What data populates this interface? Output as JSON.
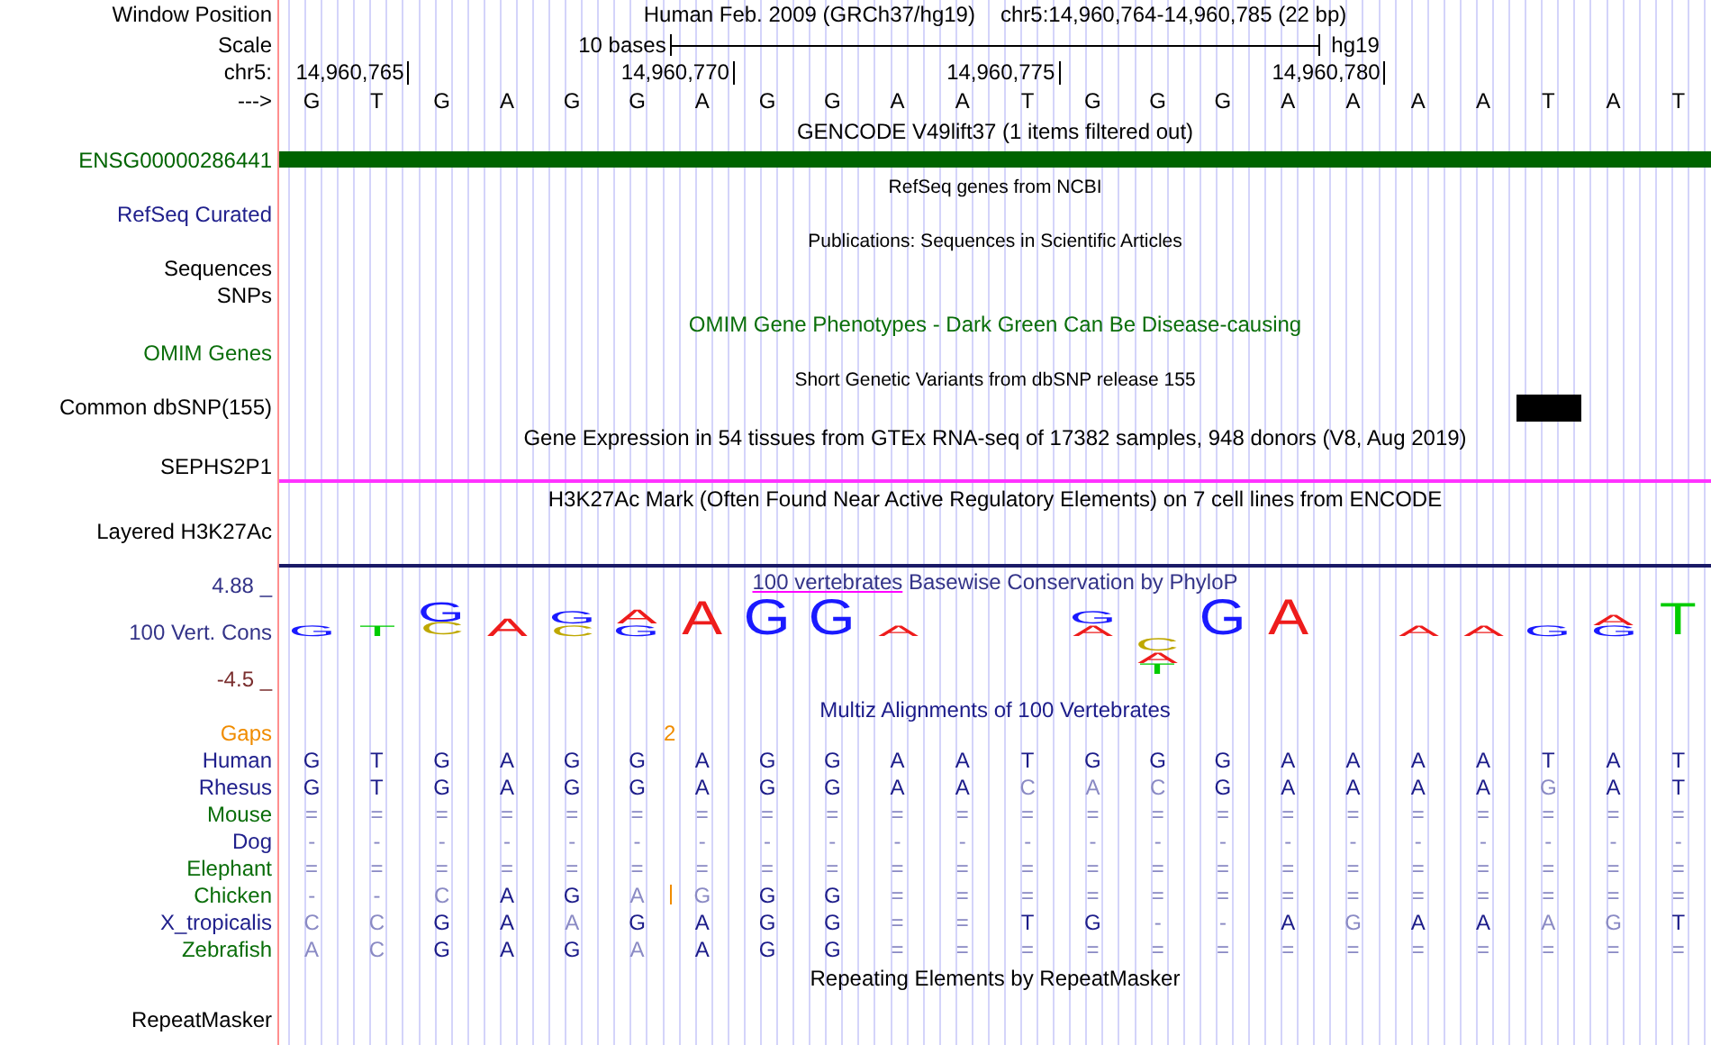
{
  "ruler": {
    "window_position_label": "Window Position",
    "assembly": "Human Feb. 2009 (GRCh37/hg19)",
    "position": "chr5:14,960,764-14,960,785 (22 bp)",
    "scale_label": "Scale",
    "scale_text": "10 bases",
    "scale_db": "hg19",
    "chrom_label": "chr5:",
    "ticks": [
      "14,960,765",
      "14,960,770",
      "14,960,775",
      "14,960,780"
    ],
    "strand_label": "--->",
    "bases": [
      "G",
      "T",
      "G",
      "A",
      "G",
      "G",
      "A",
      "G",
      "G",
      "A",
      "A",
      "T",
      "G",
      "G",
      "G",
      "A",
      "A",
      "A",
      "A",
      "T",
      "A",
      "T"
    ]
  },
  "tracks": [
    {
      "kind": "title",
      "text": "GENCODE V49lift37 (1 items filtered out)",
      "color": "#000000"
    },
    {
      "kind": "bar",
      "label": "ENSG00000286441",
      "color": "#006400"
    },
    {
      "kind": "subtitle",
      "text": "RefSeq genes from NCBI"
    },
    {
      "kind": "label",
      "label": "RefSeq Curated",
      "color": "#20208c"
    },
    {
      "kind": "subtitle",
      "text": "Publications: Sequences in Scientific Articles"
    },
    {
      "kind": "label",
      "label": "Sequences",
      "color": "#000000"
    },
    {
      "kind": "label",
      "label": "SNPs",
      "color": "#000000"
    },
    {
      "kind": "title",
      "text": "OMIM Gene Phenotypes - Dark Green Can Be Disease-causing",
      "color": "#0a6e0a"
    },
    {
      "kind": "label",
      "label": "OMIM Genes",
      "color": "#0a6e0a"
    },
    {
      "kind": "subtitle",
      "text": "Short Genetic Variants from dbSNP release 155"
    },
    {
      "kind": "variants",
      "label": "Common dbSNP(155)",
      "color": "#000000",
      "variants": [
        false,
        false,
        false,
        false,
        false,
        false,
        false,
        false,
        false,
        false,
        false,
        false,
        false,
        false,
        false,
        false,
        false,
        false,
        false,
        true,
        false,
        false
      ]
    },
    {
      "kind": "title",
      "text": "Gene Expression in 54 tissues from GTEx RNA-seq of 17382 samples, 948 donors (V8, Aug 2019)",
      "color": "#000000"
    },
    {
      "kind": "label",
      "label": "SEPHS2P1",
      "color": "#000000"
    },
    {
      "kind": "rule",
      "color": "#ff33ff"
    },
    {
      "kind": "title",
      "text": "H3K27Ac Mark (Often Found Near Active Regulatory Elements) on 7 cell lines from ENCODE",
      "color": "#000000"
    },
    {
      "kind": "signal",
      "label": "Layered H3K27Ac",
      "color": "#000000"
    },
    {
      "kind": "rule",
      "color": "#1a1a66"
    },
    {
      "kind": "conservation",
      "title_link": "100 vertebrates",
      "title_rest": "Basewise Conservation by PhyloP",
      "label": "100 Vert. Cons",
      "max": "4.88 _",
      "min": "-4.5 _",
      "columns": [
        {
          "kind": "up",
          "letters": [
            {
              "base": "G",
              "color": "#1a1aff"
            }
          ]
        },
        {
          "kind": "up",
          "letters": [
            {
              "base": "T",
              "color": "#00cc00"
            }
          ]
        },
        {
          "kind": "up",
          "letters": [
            {
              "base": "G",
              "color": "#1a1aff"
            },
            {
              "base": "C",
              "color": "#bfa800"
            }
          ]
        },
        {
          "kind": "up",
          "letters": [
            {
              "base": "A",
              "color": "#ee1c1c"
            }
          ]
        },
        {
          "kind": "up",
          "letters": [
            {
              "base": "G",
              "color": "#1a1aff"
            },
            {
              "base": "C",
              "color": "#bfa800"
            }
          ]
        },
        {
          "kind": "up",
          "letters": [
            {
              "base": "A",
              "color": "#ee1c1c"
            },
            {
              "base": "G",
              "color": "#1a1aff"
            }
          ]
        },
        {
          "kind": "up",
          "letters": [
            {
              "base": "A",
              "color": "#ee1c1c"
            }
          ]
        },
        {
          "kind": "up",
          "letters": [
            {
              "base": "G",
              "color": "#1a1aff"
            }
          ]
        },
        {
          "kind": "up",
          "letters": [
            {
              "base": "G",
              "color": "#1a1aff"
            }
          ]
        },
        {
          "kind": "up",
          "letters": [
            {
              "base": "A",
              "color": "#ee1c1c"
            }
          ]
        },
        {
          "kind": "none"
        },
        {
          "kind": "none"
        },
        {
          "kind": "up",
          "letters": [
            {
              "base": "G",
              "color": "#1a1aff"
            },
            {
              "base": "A",
              "color": "#ee1c1c"
            }
          ]
        },
        {
          "kind": "down",
          "letters": [
            {
              "base": "C",
              "color": "#bfa800"
            },
            {
              "base": "A",
              "color": "#ee1c1c"
            },
            {
              "base": "T",
              "color": "#00cc00"
            }
          ]
        },
        {
          "kind": "up",
          "letters": [
            {
              "base": "G",
              "color": "#1a1aff"
            }
          ]
        },
        {
          "kind": "up",
          "letters": [
            {
              "base": "A",
              "color": "#ee1c1c"
            }
          ]
        },
        {
          "kind": "none"
        },
        {
          "kind": "up",
          "letters": [
            {
              "base": "A",
              "color": "#ee1c1c"
            }
          ]
        },
        {
          "kind": "up",
          "letters": [
            {
              "base": "A",
              "color": "#ee1c1c"
            }
          ]
        },
        {
          "kind": "up",
          "letters": [
            {
              "base": "G",
              "color": "#1a1aff"
            }
          ]
        },
        {
          "kind": "up",
          "letters": [
            {
              "base": "A",
              "color": "#ee1c1c"
            },
            {
              "base": "G",
              "color": "#1a1aff"
            }
          ]
        },
        {
          "kind": "up",
          "letters": [
            {
              "base": "T",
              "color": "#00cc00"
            }
          ]
        }
      ]
    },
    {
      "kind": "alignment",
      "title": "Multiz Alignments of 100 Vertebrates",
      "gaps": {
        "label": "Gaps",
        "text": "2",
        "after": [
          false,
          false,
          false,
          false,
          false,
          true,
          false,
          false,
          false,
          false,
          false,
          false,
          false,
          false,
          false,
          false,
          false,
          false,
          false,
          false,
          false,
          false
        ]
      },
      "species": [
        {
          "label": "Human",
          "has_insertion": false,
          "color": "#20208c",
          "bases": [
            "G",
            "T",
            "G",
            "A",
            "G",
            "G",
            "A",
            "G",
            "G",
            "A",
            "A",
            "T",
            "G",
            "G",
            "G",
            "A",
            "A",
            "A",
            "A",
            "T",
            "A",
            "T"
          ],
          "dim": [
            false,
            false,
            false,
            false,
            false,
            false,
            false,
            false,
            false,
            false,
            false,
            false,
            false,
            false,
            false,
            false,
            false,
            false,
            false,
            false,
            false,
            false
          ]
        },
        {
          "label": "Rhesus",
          "has_insertion": false,
          "color": "#20208c",
          "bases": [
            "G",
            "T",
            "G",
            "A",
            "G",
            "G",
            "A",
            "G",
            "G",
            "A",
            "A",
            "C",
            "A",
            "C",
            "G",
            "A",
            "A",
            "A",
            "A",
            "G",
            "A",
            "T"
          ],
          "dim": [
            false,
            false,
            false,
            false,
            false,
            false,
            false,
            false,
            false,
            false,
            false,
            true,
            true,
            true,
            false,
            false,
            false,
            false,
            false,
            true,
            false,
            false
          ]
        },
        {
          "label": "Mouse",
          "has_insertion": false,
          "color": "#0a6e0a",
          "bases": [
            "=",
            "=",
            "=",
            "=",
            "=",
            "=",
            "=",
            "=",
            "=",
            "=",
            "=",
            "=",
            "=",
            "=",
            "=",
            "=",
            "=",
            "=",
            "=",
            "=",
            "=",
            "="
          ],
          "dim": [
            true,
            true,
            true,
            true,
            true,
            true,
            true,
            true,
            true,
            true,
            true,
            true,
            true,
            true,
            true,
            true,
            true,
            true,
            true,
            true,
            true,
            true
          ]
        },
        {
          "label": "Dog",
          "has_insertion": false,
          "color": "#20208c",
          "bases": [
            "-",
            "-",
            "-",
            "-",
            "-",
            "-",
            "-",
            "-",
            "-",
            "-",
            "-",
            "-",
            "-",
            "-",
            "-",
            "-",
            "-",
            "-",
            "-",
            "-",
            "-",
            "-"
          ],
          "dim": [
            true,
            true,
            true,
            true,
            true,
            true,
            true,
            true,
            true,
            true,
            true,
            true,
            true,
            true,
            true,
            true,
            true,
            true,
            true,
            true,
            true,
            true
          ]
        },
        {
          "label": "Elephant",
          "has_insertion": false,
          "color": "#0a6e0a",
          "bases": [
            "=",
            "=",
            "=",
            "=",
            "=",
            "=",
            "=",
            "=",
            "=",
            "=",
            "=",
            "=",
            "=",
            "=",
            "=",
            "=",
            "=",
            "=",
            "=",
            "=",
            "=",
            "="
          ],
          "dim": [
            true,
            true,
            true,
            true,
            true,
            true,
            true,
            true,
            true,
            true,
            true,
            true,
            true,
            true,
            true,
            true,
            true,
            true,
            true,
            true,
            true,
            true
          ]
        },
        {
          "label": "Chicken",
          "color": "#0a6e0a",
          "bases": [
            "-",
            "-",
            "C",
            "A",
            "G",
            "A",
            "G",
            "G",
            "G",
            "=",
            "=",
            "=",
            "=",
            "=",
            "=",
            "=",
            "=",
            "=",
            "=",
            "=",
            "=",
            "="
          ],
          "dim": [
            true,
            true,
            true,
            false,
            false,
            true,
            true,
            false,
            false,
            true,
            true,
            true,
            true,
            true,
            true,
            true,
            true,
            true,
            true,
            true,
            true,
            true
          ],
          "has_insertion": true
        },
        {
          "label": "X_tropicalis",
          "has_insertion": false,
          "color": "#20208c",
          "bases": [
            "C",
            "C",
            "G",
            "A",
            "A",
            "G",
            "A",
            "G",
            "G",
            "=",
            "=",
            "T",
            "G",
            "-",
            "-",
            "A",
            "G",
            "A",
            "A",
            "A",
            "G",
            "T"
          ],
          "dim": [
            true,
            true,
            false,
            false,
            true,
            false,
            false,
            false,
            false,
            true,
            true,
            false,
            false,
            true,
            true,
            false,
            true,
            false,
            false,
            true,
            true,
            false
          ]
        },
        {
          "label": "Zebrafish",
          "has_insertion": false,
          "color": "#0a6e0a",
          "bases": [
            "A",
            "C",
            "G",
            "A",
            "G",
            "A",
            "A",
            "G",
            "G",
            "=",
            "=",
            "=",
            "=",
            "=",
            "=",
            "=",
            "=",
            "=",
            "=",
            "=",
            "=",
            "="
          ],
          "dim": [
            true,
            true,
            false,
            false,
            false,
            true,
            false,
            false,
            false,
            true,
            true,
            true,
            true,
            true,
            true,
            true,
            true,
            true,
            true,
            true,
            true,
            true
          ]
        }
      ]
    },
    {
      "kind": "title",
      "text": "Repeating Elements by RepeatMasker",
      "color": "#000000"
    },
    {
      "kind": "last_label",
      "label": "RepeatMasker",
      "color": "#000000"
    }
  ]
}
